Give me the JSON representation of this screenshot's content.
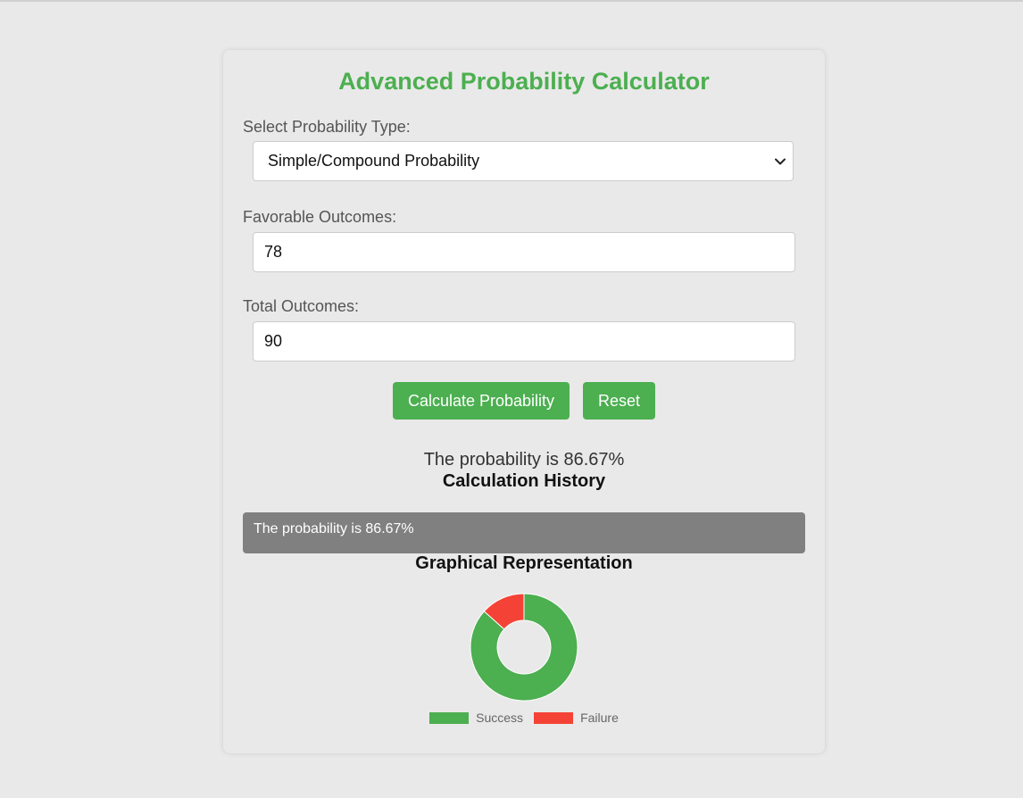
{
  "title": "Advanced Probability Calculator",
  "type_select": {
    "label": "Select Probability Type:",
    "selected": "Simple/Compound Probability"
  },
  "favorable": {
    "label": "Favorable Outcomes:",
    "value": "78"
  },
  "total": {
    "label": "Total Outcomes:",
    "value": "90"
  },
  "buttons": {
    "calculate": "Calculate Probability",
    "reset": "Reset"
  },
  "result": "The probability is 86.67%",
  "history": {
    "heading": "Calculation History",
    "items": [
      "The probability is 86.67%"
    ]
  },
  "graph": {
    "heading": "Graphical Representation"
  },
  "colors": {
    "accent": "#4caf50",
    "failure": "#f44336",
    "history_bg": "#808080"
  },
  "chart_data": {
    "type": "pie",
    "categories": [
      "Success",
      "Failure"
    ],
    "values": [
      86.67,
      13.33
    ],
    "colors": [
      "#4caf50",
      "#f44336"
    ],
    "legend_position": "bottom"
  }
}
